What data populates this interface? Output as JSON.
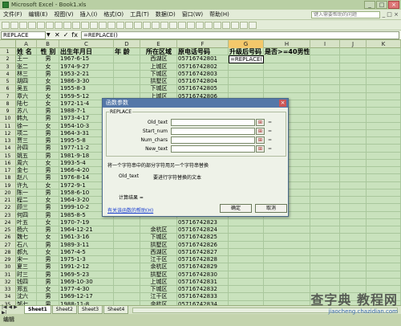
{
  "window": {
    "title": "Microsoft Excel - Book1.xls"
  },
  "menu": {
    "items": [
      "文件(F)",
      "编辑(E)",
      "视图(V)",
      "插入(I)",
      "格式(O)",
      "工具(T)",
      "数据(D)",
      "窗口(W)",
      "帮助(H)"
    ],
    "help_placeholder": "键入需要帮助的问题"
  },
  "formula_bar": {
    "name_box": "REPLACE",
    "formula": "=REPLACE()"
  },
  "columns": [
    "A",
    "B",
    "C",
    "D",
    "E",
    "F",
    "G",
    "H",
    "I",
    "J",
    "K"
  ],
  "headers": [
    "姓 名",
    "性 别",
    "出生年月日",
    "年 龄",
    "所在区域",
    "原电话号码",
    "升级后号码",
    "是否>=40男性"
  ],
  "rows": [
    [
      "王一",
      "男",
      "1967-6-15",
      "",
      "西湖区",
      "05716742801",
      "=REPLACE()"
    ],
    [
      "张二",
      "女",
      "1974-9-27",
      "",
      "上城区",
      "05716742802",
      ""
    ],
    [
      "林三",
      "男",
      "1953-2-21",
      "",
      "下城区",
      "05716742803",
      ""
    ],
    [
      "胡四",
      "女",
      "1986-3-30",
      "",
      "拱墅区",
      "05716742804",
      ""
    ],
    [
      "吴五",
      "男",
      "1955-8-3",
      "",
      "下城区",
      "05716742805",
      ""
    ],
    [
      "章六",
      "女",
      "1959-5-12",
      "",
      "上城区",
      "05716742806",
      ""
    ],
    [
      "陆七",
      "女",
      "1972-11-4",
      "",
      "",
      "",
      ""
    ],
    [
      "苏八",
      "男",
      "1988-7-1",
      "",
      "",
      "",
      ""
    ],
    [
      "韩九",
      "男",
      "1973-4-17",
      "",
      "",
      "",
      ""
    ],
    [
      "徐一",
      "女",
      "1954-10-3",
      "",
      "",
      "",
      ""
    ],
    [
      "项二",
      "男",
      "1964-3-31",
      "",
      "",
      "",
      ""
    ],
    [
      "贾三",
      "男",
      "1995-5-8",
      "",
      "",
      "",
      ""
    ],
    [
      "孙四",
      "男",
      "1977-11-2",
      "",
      "",
      "",
      ""
    ],
    [
      "姚五",
      "男",
      "1981-9-18",
      "",
      "",
      "",
      ""
    ],
    [
      "周六",
      "女",
      "1993-5-4",
      "",
      "",
      "",
      ""
    ],
    [
      "金七",
      "男",
      "1966-4-20",
      "",
      "",
      "",
      ""
    ],
    [
      "赵八",
      "男",
      "1976-8-14",
      "",
      "",
      "",
      ""
    ],
    [
      "许九",
      "女",
      "1972-9-1",
      "",
      "",
      "",
      ""
    ],
    [
      "陈一",
      "男",
      "1958-6-10",
      "",
      "",
      "",
      ""
    ],
    [
      "程二",
      "女",
      "1964-3-20",
      "",
      "",
      "",
      ""
    ],
    [
      "顾三",
      "男",
      "1999-10-2",
      "",
      "",
      "",
      ""
    ],
    [
      "何四",
      "男",
      "1985-8-5",
      "",
      "",
      "",
      ""
    ],
    [
      "叶五",
      "女",
      "1970-7-19",
      "",
      "",
      "05716742823",
      ""
    ],
    [
      "杨六",
      "男",
      "1964-12-21",
      "",
      "余杭区",
      "05716742824",
      ""
    ],
    [
      "魏七",
      "女",
      "1961-3-16",
      "",
      "下城区",
      "05716742825",
      ""
    ],
    [
      "石八",
      "男",
      "1989-3-11",
      "",
      "拱墅区",
      "05716742826",
      ""
    ],
    [
      "郝九",
      "女",
      "1967-4-5",
      "",
      "西湖区",
      "05716742827",
      ""
    ],
    [
      "宋一",
      "男",
      "1975-1-3",
      "",
      "江干区",
      "05716742828",
      ""
    ],
    [
      "夏三",
      "男",
      "1991-2-12",
      "",
      "余杭区",
      "05716742829",
      ""
    ],
    [
      "时三",
      "男",
      "1969-5-23",
      "",
      "拱墅区",
      "05716742830",
      ""
    ],
    [
      "钱四",
      "男",
      "1969-10-30",
      "",
      "上城区",
      "05716742831",
      ""
    ],
    [
      "郑五",
      "女",
      "1977-4-30",
      "",
      "下城区",
      "05716742832",
      ""
    ],
    [
      "沈六",
      "男",
      "1969-12-17",
      "",
      "江干区",
      "05716742833",
      ""
    ],
    [
      "邹七",
      "男",
      "1988-11-8",
      "",
      "余杭区",
      "05716742834",
      ""
    ],
    [
      "刘八",
      "女",
      "1964-4-1",
      "",
      "西湖区",
      "05716742835",
      ""
    ]
  ],
  "dialog": {
    "title": "函数参数",
    "group_title": "REPLACE",
    "args": [
      "Old_text",
      "Start_num",
      "Num_chars",
      "New_text"
    ],
    "ref_glyph": "⊞",
    "eq": "=",
    "description": "将一个字符串中的部分字符用另一个字符串替换",
    "arg_name": "Old_text",
    "arg_description": "要进行字符替换的文本",
    "result_label": "计算结果 =",
    "help_link": "有关该函数的帮助(H)",
    "ok": "确定",
    "cancel": "取消"
  },
  "sheets": [
    "Sheet1",
    "Sheet2",
    "Sheet3",
    "Sheet4"
  ],
  "status": "编辑",
  "watermark": {
    "line1": "查字典 教程网",
    "line2": "jiaocheng.chazidian.com"
  }
}
